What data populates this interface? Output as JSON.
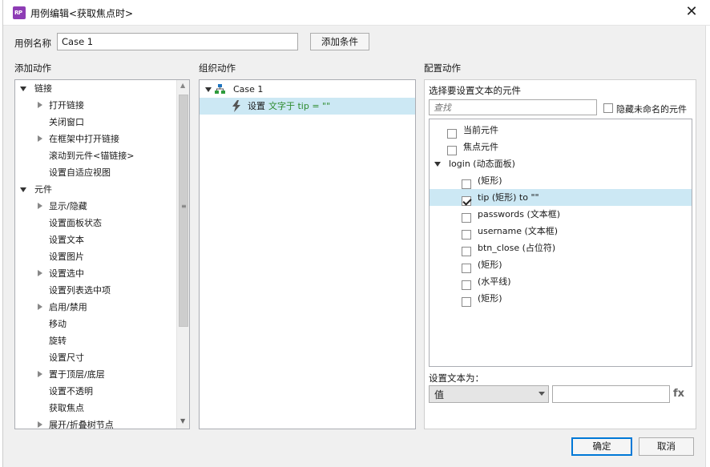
{
  "window": {
    "title": "用例编辑<获取焦点时>",
    "app_icon_text": "RP",
    "close_glyph": "✕"
  },
  "case_name": {
    "label": "用例名称",
    "value": "Case 1",
    "add_condition_label": "添加条件"
  },
  "add_actions": {
    "heading": "添加动作",
    "items": [
      {
        "label": "链接",
        "level": 0,
        "expand": "open"
      },
      {
        "label": "打开链接",
        "level": 1,
        "expand": "closed"
      },
      {
        "label": "关闭窗口",
        "level": 1,
        "expand": "none"
      },
      {
        "label": "在框架中打开链接",
        "level": 1,
        "expand": "closed"
      },
      {
        "label": "滚动到元件<锚链接>",
        "level": 1,
        "expand": "none"
      },
      {
        "label": "设置自适应视图",
        "level": 1,
        "expand": "none"
      },
      {
        "label": "元件",
        "level": 0,
        "expand": "open"
      },
      {
        "label": "显示/隐藏",
        "level": 1,
        "expand": "closed"
      },
      {
        "label": "设置面板状态",
        "level": 1,
        "expand": "none"
      },
      {
        "label": "设置文本",
        "level": 1,
        "expand": "none"
      },
      {
        "label": "设置图片",
        "level": 1,
        "expand": "none"
      },
      {
        "label": "设置选中",
        "level": 1,
        "expand": "closed"
      },
      {
        "label": "设置列表选中项",
        "level": 1,
        "expand": "none"
      },
      {
        "label": "启用/禁用",
        "level": 1,
        "expand": "closed"
      },
      {
        "label": "移动",
        "level": 1,
        "expand": "none"
      },
      {
        "label": "旋转",
        "level": 1,
        "expand": "none"
      },
      {
        "label": "设置尺寸",
        "level": 1,
        "expand": "none"
      },
      {
        "label": "置于顶层/底层",
        "level": 1,
        "expand": "closed"
      },
      {
        "label": "设置不透明",
        "level": 1,
        "expand": "none"
      },
      {
        "label": "获取焦点",
        "level": 1,
        "expand": "none"
      },
      {
        "label": "展开/折叠树节点",
        "level": 1,
        "expand": "closed"
      }
    ]
  },
  "organize_actions": {
    "heading": "组织动作",
    "case_label": "Case 1",
    "action_prefix": "设置",
    "action_detail": "文字于 tip = \"\""
  },
  "configure_actions": {
    "heading": "配置动作",
    "select_prompt": "选择要设置文本的元件",
    "search_placeholder": "查找",
    "hide_unnamed_label": "隐藏未命名的元件",
    "widgets": [
      {
        "label": "当前元件",
        "level": 0,
        "type": "check",
        "checked": false
      },
      {
        "label": "焦点元件",
        "level": 0,
        "type": "check",
        "checked": false
      },
      {
        "label": "login (动态面板)",
        "level": 0,
        "type": "group",
        "checked": false
      },
      {
        "label": "(矩形)",
        "level": 1,
        "type": "check",
        "checked": false
      },
      {
        "label": "tip (矩形) to \"\"",
        "level": 1,
        "type": "check",
        "checked": true
      },
      {
        "label": "passwords (文本框)",
        "level": 1,
        "type": "check",
        "checked": false
      },
      {
        "label": "username (文本框)",
        "level": 1,
        "type": "check",
        "checked": false
      },
      {
        "label": "btn_close (占位符)",
        "level": 1,
        "type": "check",
        "checked": false
      },
      {
        "label": "(矩形)",
        "level": 1,
        "type": "check",
        "checked": false
      },
      {
        "label": "(水平线)",
        "level": 1,
        "type": "check",
        "checked": false
      },
      {
        "label": "(矩形)",
        "level": 1,
        "type": "check",
        "checked": false
      }
    ],
    "set_text_label": "设置文本为：",
    "value_type": "值",
    "value_input": "",
    "fx_label": "fx"
  },
  "footer": {
    "ok_label": "确定",
    "cancel_label": "取消"
  }
}
